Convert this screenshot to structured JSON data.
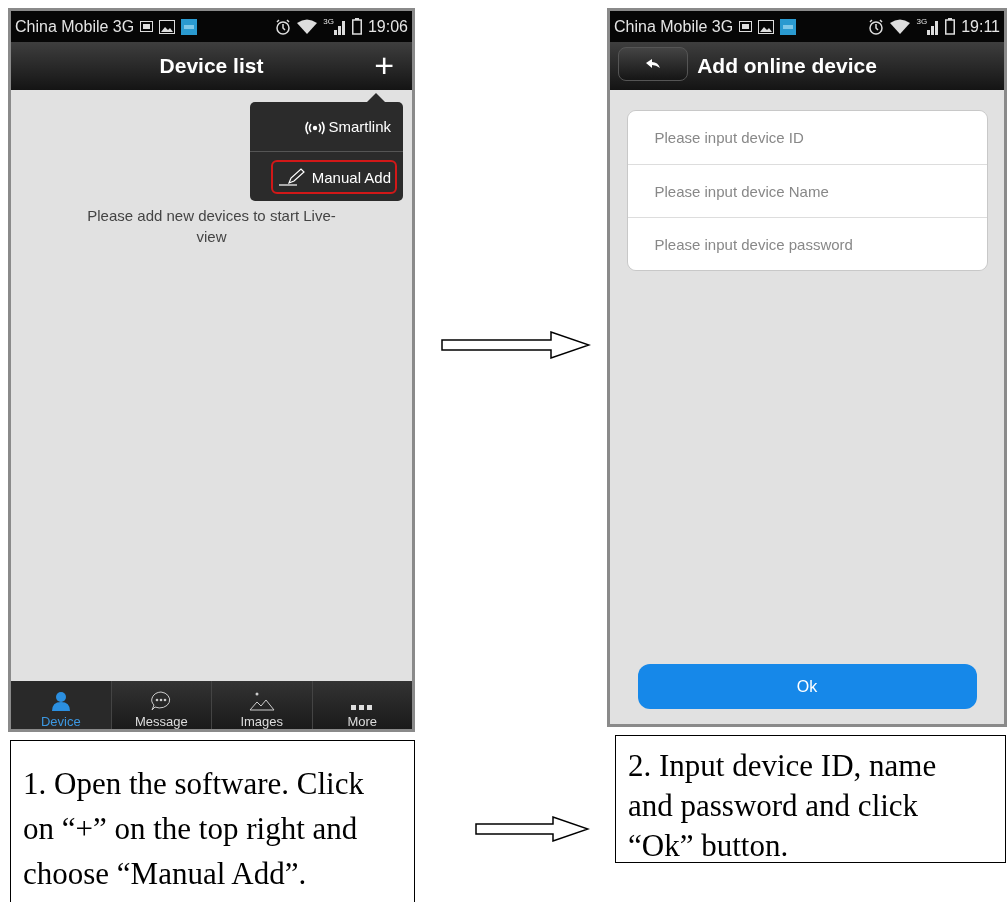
{
  "screens": [
    {
      "status_bar": {
        "carrier": "China Mobile 3G",
        "network_type": "3G",
        "time": "19:06"
      },
      "header": {
        "title": "Device list",
        "back_button": false,
        "action": "+"
      },
      "popup_menu": [
        {
          "kind": "smartlink",
          "label": "Smartlink",
          "highlighted": false
        },
        {
          "kind": "manual",
          "label": "Manual Add",
          "highlighted": true
        }
      ],
      "message": "Please add new devices to start Live-view",
      "tabs": [
        {
          "kind": "device",
          "label": "Device",
          "selected": true
        },
        {
          "kind": "message",
          "label": "Message",
          "selected": false
        },
        {
          "kind": "images",
          "label": "Images",
          "selected": false
        },
        {
          "kind": "more",
          "label": "More",
          "selected": false
        }
      ]
    },
    {
      "status_bar": {
        "carrier": "China Mobile 3G",
        "network_type": "3G",
        "time": "19:11"
      },
      "header": {
        "title": "Add online device",
        "back_button": true
      },
      "fields": [
        {
          "placeholder": "Please input device ID"
        },
        {
          "placeholder": "Please input device Name"
        },
        {
          "placeholder": "Please input device password"
        }
      ],
      "button": "Ok"
    }
  ],
  "captions": [
    "1. Open the software. Click on “+” on the top right and choose “Manual Add”.",
    "2. Input device ID, name and password and click “Ok” button."
  ]
}
